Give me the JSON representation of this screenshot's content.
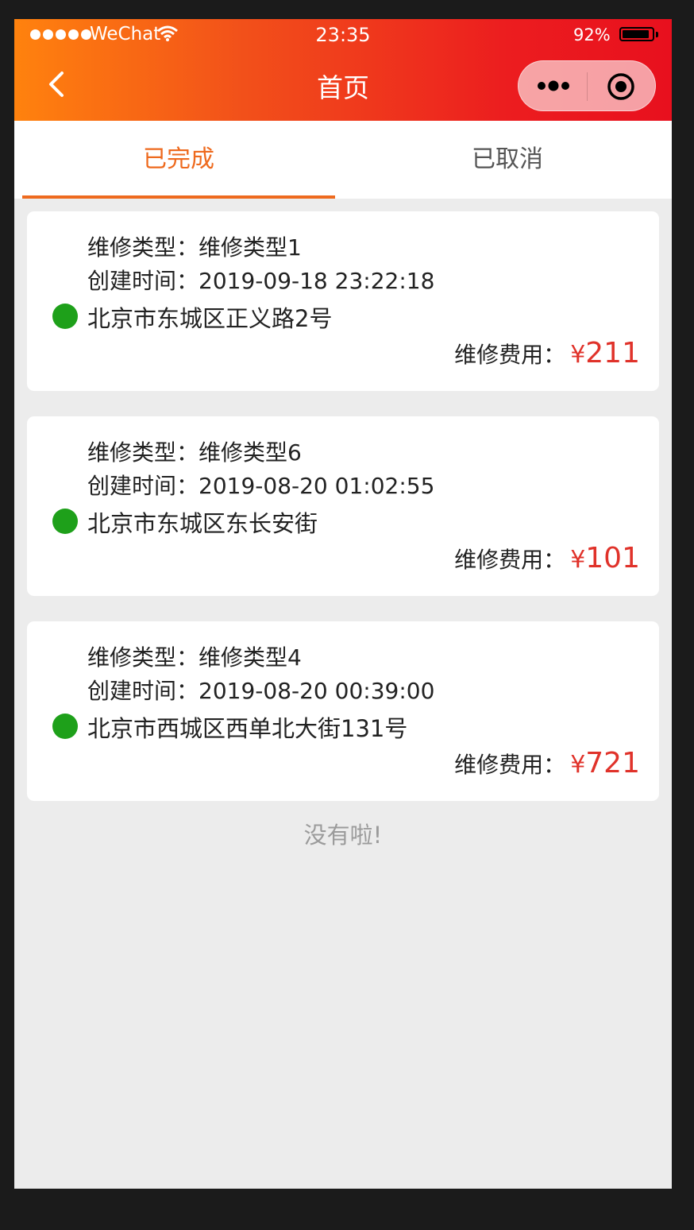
{
  "status_bar": {
    "carrier": "WeChat",
    "time": "23:35",
    "battery": "92%",
    "battery_level": 0.92
  },
  "nav": {
    "title": "首页"
  },
  "tabs": [
    {
      "label": "已完成",
      "active": true
    },
    {
      "label": "已取消",
      "active": false
    }
  ],
  "orders": [
    {
      "type_label": "维修类型：",
      "type_value": "维修类型1",
      "created_label": "创建时间：",
      "created_value": "2019-09-18 23:22:18",
      "address": "北京市东城区正义路2号",
      "fee_label": "维修费用：",
      "currency": "¥",
      "fee": "211"
    },
    {
      "type_label": "维修类型：",
      "type_value": "维修类型6",
      "created_label": "创建时间：",
      "created_value": "2019-08-20 01:02:55",
      "address": "北京市东城区东长安街",
      "fee_label": "维修费用：",
      "currency": "¥",
      "fee": "101"
    },
    {
      "type_label": "维修类型：",
      "type_value": "维修类型4",
      "created_label": "创建时间：",
      "created_value": "2019-08-20 00:39:00",
      "address": "北京市西城区西单北大街131号",
      "fee_label": "维修费用：",
      "currency": "¥",
      "fee": "721"
    }
  ],
  "end_note": "没有啦!",
  "colors": {
    "accent": "#ee6a1e",
    "price": "#e0322a",
    "status_dot": "#1ea01a",
    "background": "#ececec"
  },
  "icons": {
    "back": "chevron-left-icon",
    "more": "more-dots-icon",
    "close": "target-circle-icon",
    "status": "green-dot-icon"
  }
}
